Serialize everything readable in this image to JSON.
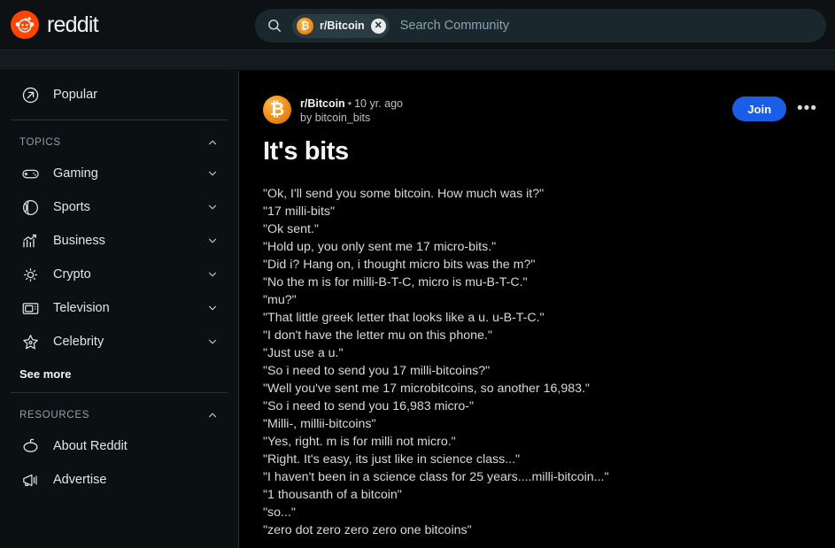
{
  "header": {
    "brand_label": "reddit",
    "logo_icon": "reddit-alien-icon",
    "search": {
      "search_icon": "search-icon",
      "chip_label": "r/Bitcoin",
      "chip_avatar_glyph": "₿",
      "chip_clear_icon": "close-icon",
      "chip_clear_glyph": "✕",
      "placeholder": "Search Community",
      "value": ""
    }
  },
  "sidebar": {
    "primary": [
      {
        "label": "Popular",
        "icon": "popular-arrow-icon"
      }
    ],
    "sections": [
      {
        "title": "TOPICS",
        "collapse_icon": "chevron-up-icon",
        "items": [
          {
            "label": "Gaming",
            "icon": "gamepad-icon",
            "chevron": "chevron-down-icon"
          },
          {
            "label": "Sports",
            "icon": "sports-ball-icon",
            "chevron": "chevron-down-icon"
          },
          {
            "label": "Business",
            "icon": "bar-chart-icon",
            "chevron": "chevron-down-icon"
          },
          {
            "label": "Crypto",
            "icon": "crypto-sun-icon",
            "chevron": "chevron-down-icon"
          },
          {
            "label": "Television",
            "icon": "television-icon",
            "chevron": "chevron-down-icon"
          },
          {
            "label": "Celebrity",
            "icon": "star-icon",
            "chevron": "chevron-down-icon"
          }
        ],
        "see_more_label": "See more"
      },
      {
        "title": "RESOURCES",
        "collapse_icon": "chevron-up-icon",
        "items": [
          {
            "label": "About Reddit",
            "icon": "reddit-snoo-icon",
            "chevron": ""
          },
          {
            "label": "Advertise",
            "icon": "megaphone-icon",
            "chevron": ""
          }
        ]
      }
    ]
  },
  "post": {
    "avatar_icon": "bitcoin-icon",
    "avatar_glyph": "₿",
    "subreddit": "r/Bitcoin",
    "meta_dot": "•",
    "age": "10 yr. ago",
    "byline_prefix": "by ",
    "author": "bitcoin_bits",
    "join_label": "Join",
    "more_label": "•••",
    "title": "It's bits",
    "body_lines": [
      "\"Ok, I'll send you some bitcoin. How much was it?\"",
      "\"17 milli-bits\"",
      "\"Ok sent.\"",
      "\"Hold up, you only sent me 17 micro-bits.\"",
      "\"Did i? Hang on, i thought micro bits was the m?\"",
      "\"No the m is for milli-B-T-C, micro is mu-B-T-C.\"",
      "\"mu?\"",
      "\"That little greek letter that looks like a u. u-B-T-C.\"",
      "\"I don't have the letter mu on this phone.\"",
      "\"Just use a u.\"",
      "\"So i need to send you 17 milli-bitcoins?\"",
      "\"Well you've sent me 17 microbitcoins, so another 16,983.\"",
      "\"So i need to send you 16,983 micro-\"",
      "\"Milli-, millii-bitcoins\"",
      "\"Yes, right. m is for milli not micro.\"",
      "\"Right. It's easy, its just like in science class...\"",
      "\"I haven't been in a science class for 25 years....milli-bitcoin...\"",
      "\"1 thousanth of a bitcoin\"",
      "\"so...\"",
      "\"zero dot zero zero zero one bitcoins\""
    ]
  },
  "colors": {
    "brand_orange": "#ff4500",
    "join_blue": "#1a5ee8",
    "bitcoin_orange": "#f7931a",
    "sidebar_bg": "#0b1013",
    "header_bg": "#0e1113",
    "main_bg": "#000000"
  }
}
